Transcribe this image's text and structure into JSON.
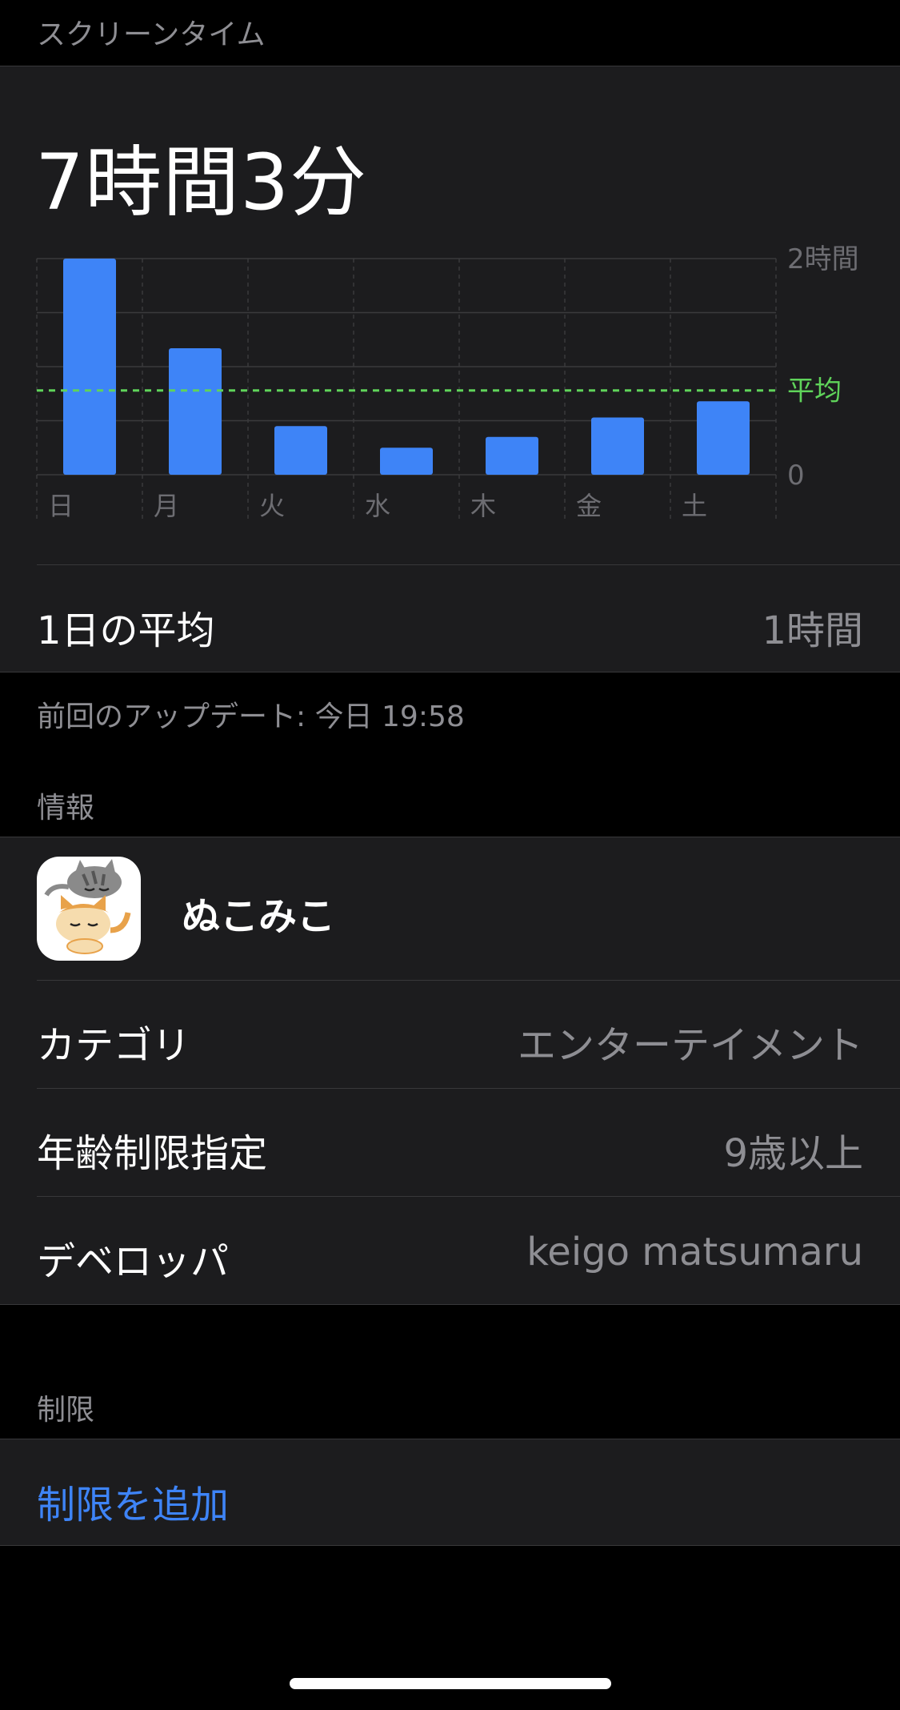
{
  "header": {
    "title": "スクリーンタイム"
  },
  "summary": {
    "total": "7時間3分",
    "daily_average_label": "1日の平均",
    "daily_average_value": "1時間",
    "last_update": "前回のアップデート: 今日 19:58"
  },
  "chart_data": {
    "type": "bar",
    "categories": [
      "日",
      "月",
      "火",
      "水",
      "木",
      "金",
      "土"
    ],
    "values": [
      2.0,
      1.17,
      0.45,
      0.25,
      0.35,
      0.53,
      0.68
    ],
    "y_unit": "時間",
    "ylim": [
      0,
      2
    ],
    "ytick_labels": [
      "0",
      "2時間"
    ],
    "average": {
      "label": "平均",
      "value": 0.78
    },
    "bar_color": "#3e84f7",
    "average_color": "#5fd35a",
    "grid": true
  },
  "info": {
    "section_title": "情報",
    "app_name": "ぬこみこ",
    "icon": "cat-app-icon",
    "rows": [
      {
        "label": "カテゴリ",
        "value": "エンターテイメント"
      },
      {
        "label": "年齢制限指定",
        "value": "9歳以上"
      },
      {
        "label": "デベロッパ",
        "value": "keigo matsumaru"
      }
    ]
  },
  "limits": {
    "section_title": "制限",
    "add_limit_label": "制限を追加"
  },
  "colors": {
    "background": "#000000",
    "card": "#1c1c1e",
    "accent": "#3e84f7",
    "average_line": "#5fd35a",
    "secondary_text": "#8e8e93"
  }
}
